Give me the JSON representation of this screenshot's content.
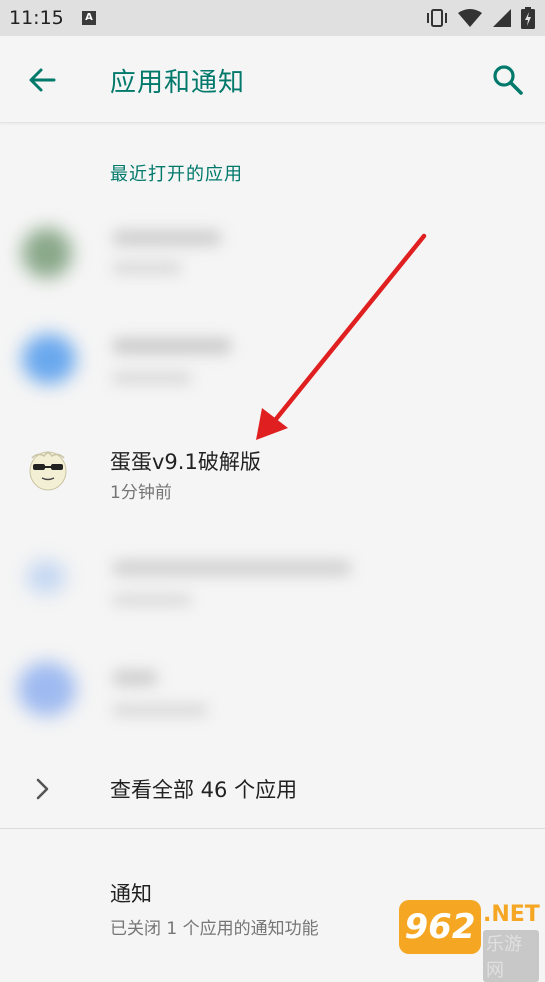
{
  "status_bar": {
    "time": "11:15",
    "notification_icon": "A"
  },
  "app_bar": {
    "title": "应用和通知"
  },
  "recent_apps": {
    "header": "最近打开的应用",
    "visible_app": {
      "name": "蛋蛋v9.1破解版",
      "time": "1分钟前"
    }
  },
  "see_all": {
    "label": "查看全部 46 个应用"
  },
  "notifications": {
    "title": "通知",
    "subtitle": "已关闭 1 个应用的通知功能"
  },
  "watermark": {
    "number": "962",
    "suffix": ".NET",
    "site_name": "乐游网"
  },
  "colors": {
    "accent": "#00796b",
    "annotation_arrow": "#e02020",
    "background": "#f5f5f5"
  }
}
